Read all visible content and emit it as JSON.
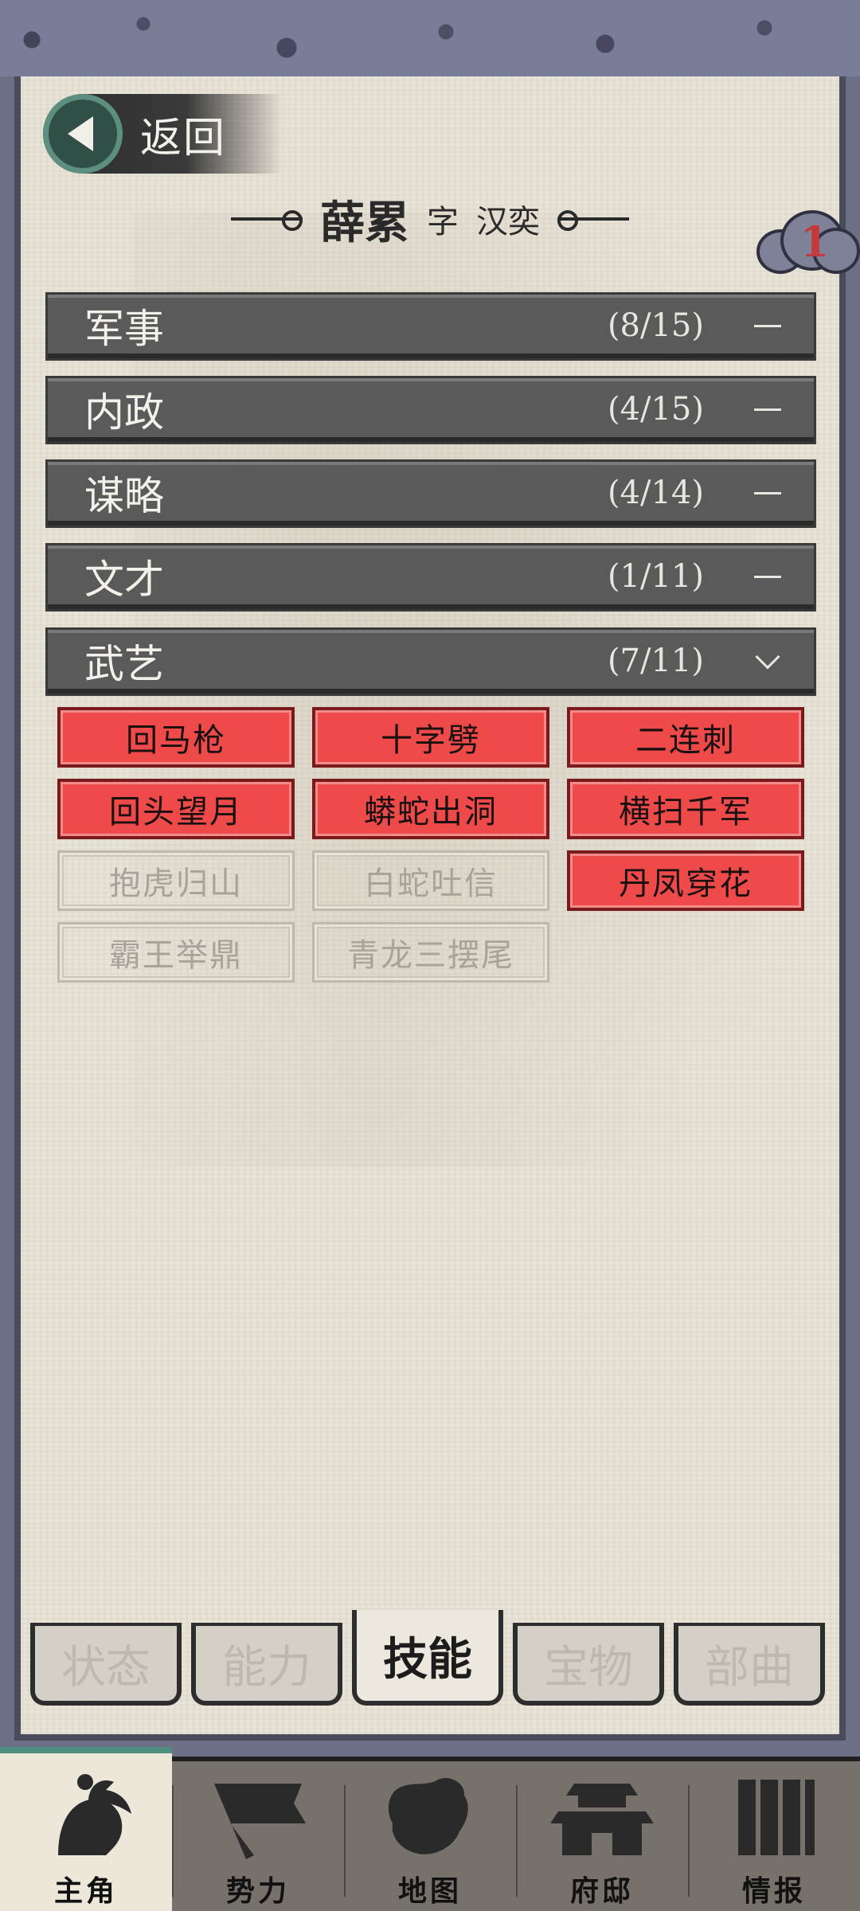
{
  "back": {
    "label": "返回"
  },
  "title": {
    "name": "薛累",
    "style_prefix": "字",
    "style_name": "汉奕"
  },
  "badge": {
    "count": "1"
  },
  "categories": [
    {
      "name": "军事",
      "count": "(8/15)",
      "state": "collapsed"
    },
    {
      "name": "内政",
      "count": "(4/15)",
      "state": "collapsed"
    },
    {
      "name": "谋略",
      "count": "(4/14)",
      "state": "collapsed"
    },
    {
      "name": "文才",
      "count": "(1/11)",
      "state": "collapsed"
    },
    {
      "name": "武艺",
      "count": "(7/11)",
      "state": "expanded"
    }
  ],
  "skills": [
    {
      "name": "回马枪",
      "learned": true
    },
    {
      "name": "十字劈",
      "learned": true
    },
    {
      "name": "二连刺",
      "learned": true
    },
    {
      "name": "回头望月",
      "learned": true
    },
    {
      "name": "蟒蛇出洞",
      "learned": true
    },
    {
      "name": "横扫千军",
      "learned": true
    },
    {
      "name": "抱虎归山",
      "learned": false
    },
    {
      "name": "白蛇吐信",
      "learned": false
    },
    {
      "name": "丹凤穿花",
      "learned": true
    },
    {
      "name": "霸王举鼎",
      "learned": false
    },
    {
      "name": "青龙三摆尾",
      "learned": false
    }
  ],
  "sub_tabs": [
    {
      "label": "状态",
      "active": false
    },
    {
      "label": "能力",
      "active": false
    },
    {
      "label": "技能",
      "active": true
    },
    {
      "label": "宝物",
      "active": false
    },
    {
      "label": "部曲",
      "active": false
    }
  ],
  "bottom_nav": [
    {
      "label": "主角",
      "icon": "hero-icon",
      "active": true
    },
    {
      "label": "势力",
      "icon": "flag-icon",
      "active": false
    },
    {
      "label": "地图",
      "icon": "map-icon",
      "active": false
    },
    {
      "label": "府邸",
      "icon": "mansion-icon",
      "active": false
    },
    {
      "label": "情报",
      "icon": "scroll-icon",
      "active": false
    }
  ],
  "colors": {
    "skill_learned": "#ee4a4a",
    "category_bar": "#5a5a5a",
    "back_circle": "#2f4f47",
    "nav_accent": "#4f8f80"
  }
}
